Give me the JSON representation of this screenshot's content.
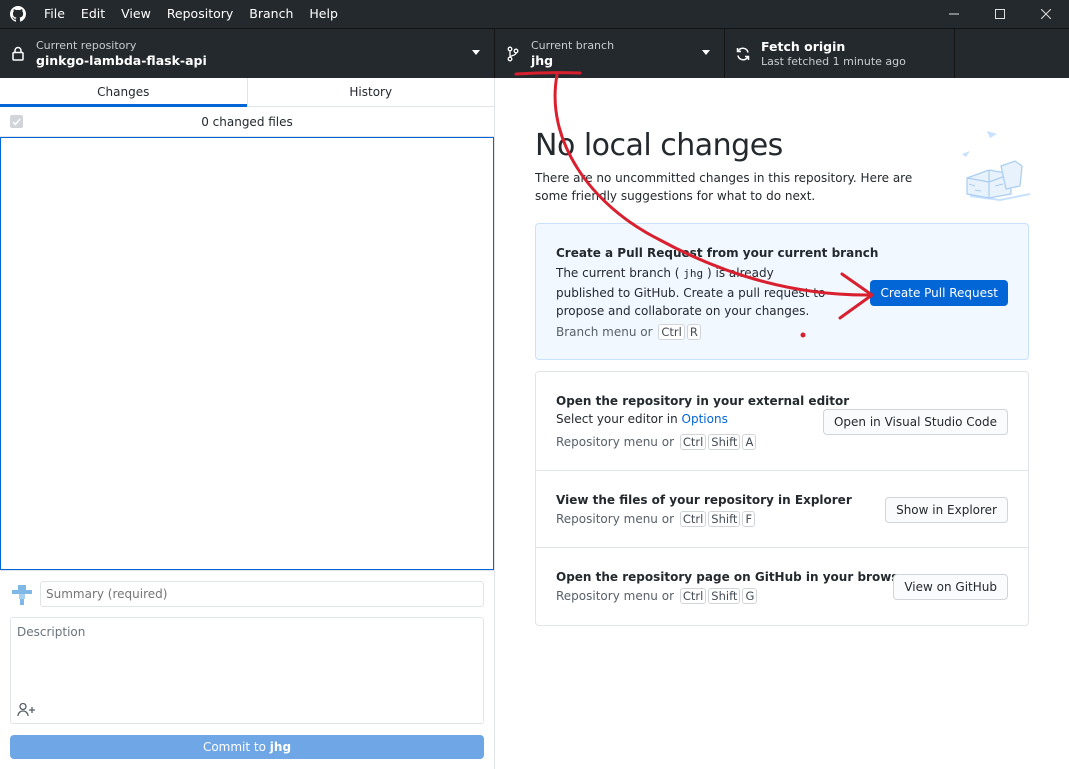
{
  "menu": {
    "items": [
      "File",
      "Edit",
      "View",
      "Repository",
      "Branch",
      "Help"
    ]
  },
  "toolbar": {
    "repo_label": "Current repository",
    "repo_value": "ginkgo-lambda-flask-api",
    "branch_label": "Current branch",
    "branch_value": "jhg",
    "fetch_title": "Fetch origin",
    "fetch_sub": "Last fetched 1 minute ago"
  },
  "left": {
    "tabs": [
      "Changes",
      "History"
    ],
    "changed_files": "0 changed files",
    "summary_placeholder": "Summary (required)",
    "description_placeholder": "Description",
    "commit_prefix": "Commit to ",
    "commit_branch": "jhg"
  },
  "right": {
    "title": "No local changes",
    "description": "There are no uncommitted changes in this repository. Here are some friendly suggestions for what to do next.",
    "pr": {
      "title": "Create a Pull Request from your current branch",
      "text_before": "The current branch (",
      "branch": "jhg",
      "text_after": ") is already published to GitHub. Create a pull request to propose and collaborate on your changes.",
      "shortcut_prefix": "Branch menu or",
      "keys": [
        "Ctrl",
        "R"
      ],
      "button": "Create Pull Request"
    },
    "editor": {
      "title": "Open the repository in your external editor",
      "sub_prefix": "Select your editor in ",
      "sub_link": "Options",
      "shortcut_prefix": "Repository menu or",
      "keys": [
        "Ctrl",
        "Shift",
        "A"
      ],
      "button": "Open in Visual Studio Code"
    },
    "explorer": {
      "title": "View the files of your repository in Explorer",
      "shortcut_prefix": "Repository menu or",
      "keys": [
        "Ctrl",
        "Shift",
        "F"
      ],
      "button": "Show in Explorer"
    },
    "github": {
      "title": "Open the repository page on GitHub in your browser",
      "shortcut_prefix": "Repository menu or",
      "keys": [
        "Ctrl",
        "Shift",
        "G"
      ],
      "button": "View on GitHub"
    }
  },
  "colors": {
    "titlebar": "#24292e",
    "accent": "#0366d6",
    "annotation": "#d9202f"
  }
}
